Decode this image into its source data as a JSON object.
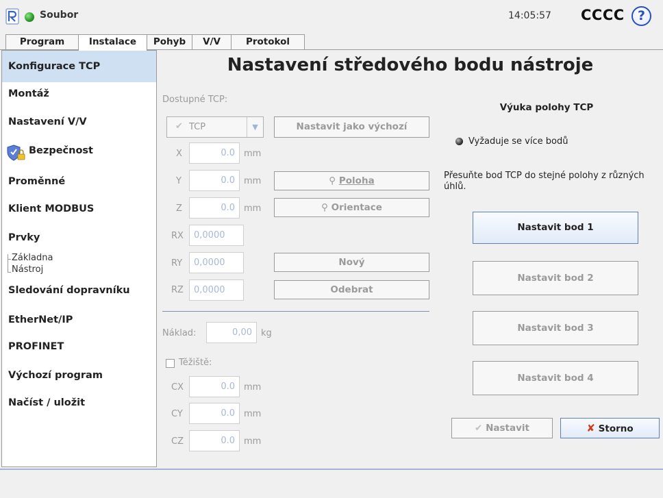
{
  "topbar": {
    "file_label": "Soubor",
    "clock": "14:05:57",
    "robot_name": "CCCC",
    "help_glyph": "?",
    "status_color": "#2f9e2a"
  },
  "tabs": [
    {
      "label": "Program",
      "active": false
    },
    {
      "label": "Instalace",
      "active": true
    },
    {
      "label": "Pohyb",
      "active": false
    },
    {
      "label": "V/V",
      "active": false
    },
    {
      "label": "Protokol",
      "active": false
    }
  ],
  "sidebar": {
    "items": [
      {
        "label": "Konfigurace TCP",
        "selected": true
      },
      {
        "label": "Montáž"
      },
      {
        "label": "Nastavení V/V"
      },
      {
        "label": "Bezpečnost",
        "icon": "shield-lock-icon"
      },
      {
        "label": "Proměnné"
      },
      {
        "label": "Klient MODBUS"
      },
      {
        "label": "Prvky"
      },
      {
        "label": "Sledování dopravníku"
      },
      {
        "label": "EtherNet/IP"
      },
      {
        "label": "PROFINET"
      },
      {
        "label": "Výchozí program"
      },
      {
        "label": "Načíst / uložit"
      }
    ],
    "sub_items": [
      "Základna",
      "Nástroj"
    ]
  },
  "main": {
    "title": "Nastavení středového bodu nástroje",
    "available_tcp_label": "Dostupné TCP:",
    "tcp_select_value": "TCP",
    "set_default_button": "Nastavit jako výchozí",
    "fields": [
      {
        "label": "X",
        "value": "0.0",
        "unit": "mm"
      },
      {
        "label": "Y",
        "value": "0.0",
        "unit": "mm"
      },
      {
        "label": "Z",
        "value": "0.0",
        "unit": "mm"
      },
      {
        "label": "RX",
        "value": "0,0000",
        "unit": ""
      },
      {
        "label": "RY",
        "value": "0,0000",
        "unit": ""
      },
      {
        "label": "RZ",
        "value": "0,0000",
        "unit": ""
      }
    ],
    "position_button": "Poloha",
    "orientation_button": "Orientace",
    "new_button": "Nový",
    "remove_button": "Odebrat",
    "payload_label": "Náklad:",
    "payload_value": "0,00",
    "payload_unit": "kg",
    "cog_label": "Těžiště:",
    "cog_fields": [
      {
        "label": "CX",
        "value": "0.0",
        "unit": "mm"
      },
      {
        "label": "CY",
        "value": "0.0",
        "unit": "mm"
      },
      {
        "label": "CZ",
        "value": "0.0",
        "unit": "mm"
      }
    ]
  },
  "teach": {
    "title": "Výuka polohy TCP",
    "status": "Vyžaduje se více bodů",
    "instruction": "Přesuňte bod TCP do stejné polohy z různých úhlů.",
    "points": [
      "Nastavit bod 1",
      "Nastavit bod 2",
      "Nastavit bod 3",
      "Nastavit bod 4"
    ],
    "set_button": "Nastavit",
    "cancel_button": "Storno"
  }
}
